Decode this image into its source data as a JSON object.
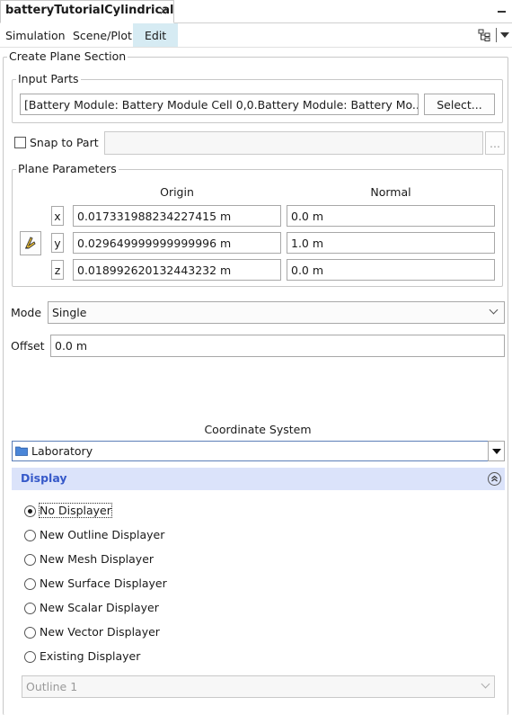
{
  "tab": {
    "title": "batteryTutorialCylindrical",
    "close_glyph": "×"
  },
  "menu": {
    "simulation": "Simulation",
    "scene_plot": "Scene/Plot",
    "edit": "Edit"
  },
  "form": {
    "title": "Create Plane Section",
    "input_parts": {
      "legend": "Input Parts",
      "value": "[Battery Module: Battery Module Cell 0,0.Battery Module: Battery Mo...",
      "select_label": "Select..."
    },
    "snap": {
      "label": "Snap to Part",
      "checked": false,
      "value": "",
      "ellipsis": "..."
    },
    "plane": {
      "legend": "Plane Parameters",
      "origin_header": "Origin",
      "normal_header": "Normal",
      "rows": [
        {
          "axis": "x",
          "origin": "0.017331988234227415 m",
          "normal": "0.0 m"
        },
        {
          "axis": "y",
          "origin": "0.029649999999999996 m",
          "normal": "1.0 m"
        },
        {
          "axis": "z",
          "origin": "0.018992620132443232 m",
          "normal": "0.0 m"
        }
      ]
    },
    "mode": {
      "label": "Mode",
      "value": "Single"
    },
    "offset": {
      "label": "Offset",
      "value": "0.0 m"
    },
    "coordinate_system": {
      "label": "Coordinate System",
      "value": "Laboratory"
    }
  },
  "display": {
    "title": "Display",
    "options": [
      {
        "label": "No Displayer",
        "selected": true
      },
      {
        "label": "New Outline Displayer",
        "selected": false
      },
      {
        "label": "New Mesh Displayer",
        "selected": false
      },
      {
        "label": "New Surface Displayer",
        "selected": false
      },
      {
        "label": "New Scalar Displayer",
        "selected": false
      },
      {
        "label": "New Vector Displayer",
        "selected": false
      },
      {
        "label": "Existing Displayer",
        "selected": false
      }
    ],
    "existing_value": "Outline 1"
  },
  "colors": {
    "accent": "#3659c9",
    "header_bg": "#dbe3fa",
    "edit_highlight": "#d6ebf3",
    "folder": "#4a86d8"
  }
}
